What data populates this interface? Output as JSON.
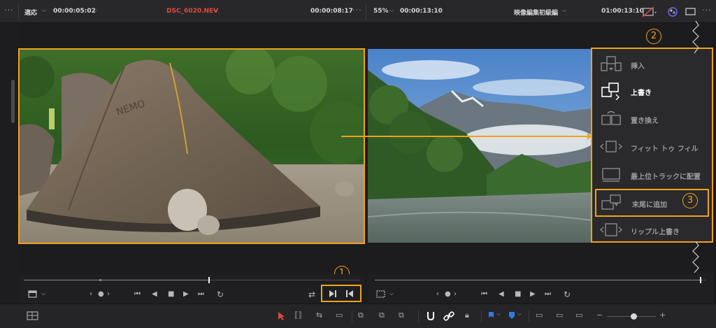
{
  "source_viewer": {
    "zoom": "適応",
    "timecode_left": "00:00:05:02",
    "clip_name": "DSC_6020.NEV",
    "timecode_right": "00:00:08:17",
    "progress": 0.55
  },
  "timeline_viewer": {
    "zoom": "55%",
    "timecode_left": "00:00:13:10",
    "timeline_name": "映像編集初級編",
    "timecode_right": "01:00:13:10",
    "progress": 0.98
  },
  "edit_overlay": {
    "items": [
      {
        "label": "挿入",
        "icon": "insert-icon"
      },
      {
        "label": "上書き",
        "icon": "overwrite-icon",
        "active": true
      },
      {
        "label": "置き換え",
        "icon": "replace-icon"
      },
      {
        "label": "フィット トゥ フィル",
        "icon": "fit-to-fill-icon"
      },
      {
        "label": "最上位トラックに配置",
        "icon": "place-on-top-icon"
      },
      {
        "label": "末尾に追加",
        "icon": "append-at-end-icon"
      },
      {
        "label": "リップル上書き",
        "icon": "ripple-overwrite-icon"
      }
    ]
  },
  "annotations": {
    "marker_1": "1",
    "marker_2": "2",
    "marker_3": "3"
  },
  "colors": {
    "accent": "#f0a11d",
    "clip_name": "#e0493b",
    "playhead": "#f2f2f2"
  }
}
